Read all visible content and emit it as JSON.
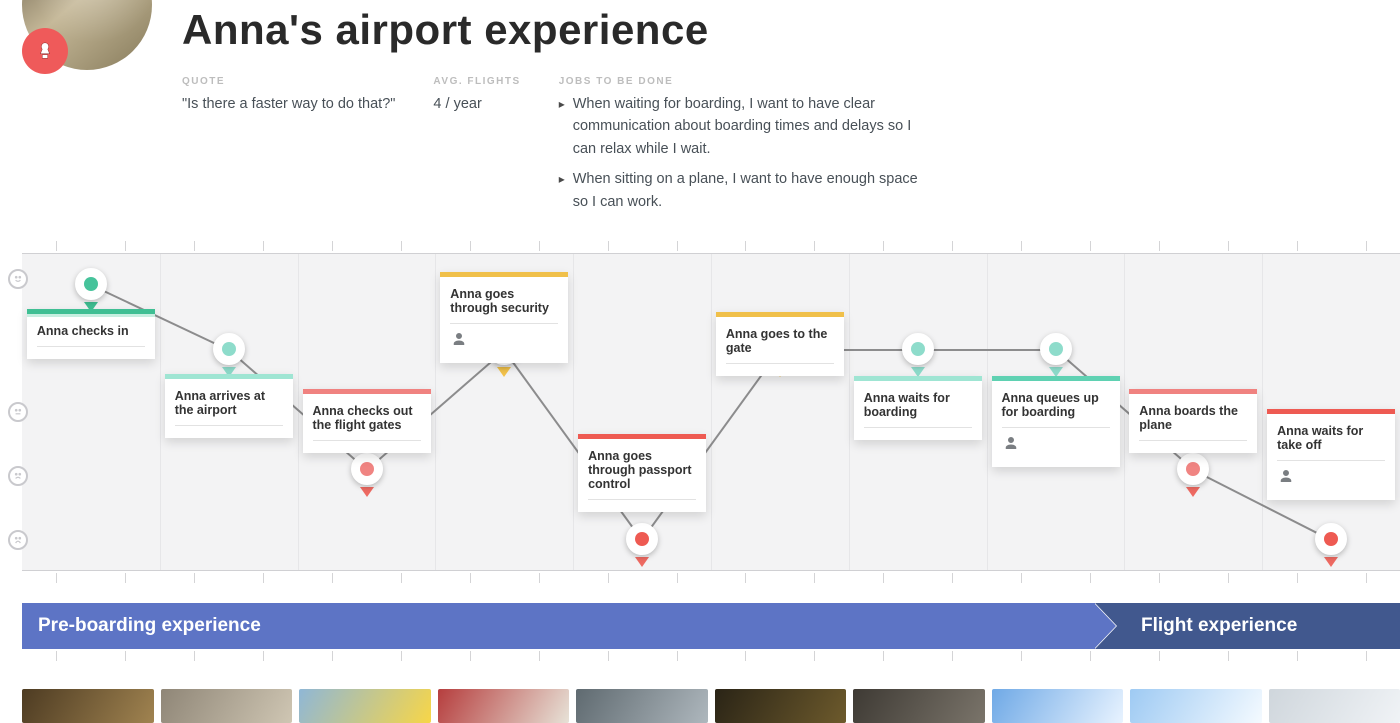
{
  "header": {
    "title": "Anna's airport experience",
    "quote_label": "QUOTE",
    "quote_value": "\"Is there a faster way to do that?\"",
    "avg_label": "AVG. FLIGHTS",
    "avg_value": "4 / year",
    "jtbd_label": "JOBS TO BE DONE",
    "jtbd": [
      "When waiting for boarding, I want to have clear communication about boarding times and delays so I can relax while I wait.",
      "When sitting on a plane, I want to have enough space so I can work."
    ]
  },
  "chart_data": {
    "type": "line",
    "y_levels": [
      "happy",
      "neutral-happy",
      "neutral-sad",
      "sad"
    ],
    "steps": [
      {
        "label": "Anna checks in",
        "level": 0,
        "palette": "green",
        "dot": "green"
      },
      {
        "label": "Anna arrives at the airport",
        "level": 1,
        "palette": "teal",
        "dot": "teal"
      },
      {
        "label": "Anna checks out the flight gates",
        "level": 2,
        "palette": "red",
        "dot": "red"
      },
      {
        "label": "Anna goes through security",
        "level": 1,
        "palette": "yellow",
        "dot": "yellow",
        "icon": "person"
      },
      {
        "label": "Anna goes through passport control",
        "level": 3,
        "palette": "redS",
        "dot": "redS"
      },
      {
        "label": "Anna goes to the gate",
        "level": 1,
        "palette": "yellow",
        "dot": "yellow"
      },
      {
        "label": "Anna waits for boarding",
        "level": 1,
        "palette": "teal",
        "dot": "teal"
      },
      {
        "label": "Anna queues up for boarding",
        "level": 1,
        "palette": "tealstrong",
        "dot": "teal",
        "icon": "person"
      },
      {
        "label": "Anna boards the plane",
        "level": 2,
        "palette": "red",
        "dot": "red"
      },
      {
        "label": "Anna waits for take off",
        "level": 3,
        "palette": "redS",
        "dot": "redS",
        "icon": "person"
      }
    ]
  },
  "phases": {
    "a": "Pre-boarding experience",
    "b": "Flight experience"
  }
}
